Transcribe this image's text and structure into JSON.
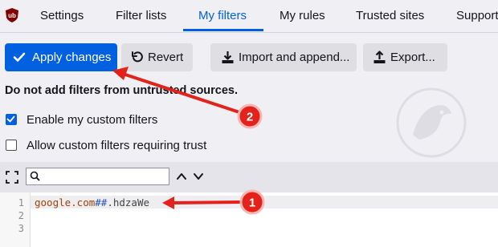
{
  "tabs": [
    {
      "label": "Settings",
      "active": false
    },
    {
      "label": "Filter lists",
      "active": false
    },
    {
      "label": "My filters",
      "active": true
    },
    {
      "label": "My rules",
      "active": false
    },
    {
      "label": "Trusted sites",
      "active": false
    },
    {
      "label": "Support",
      "active": false
    }
  ],
  "toolbar": {
    "apply_label": "Apply changes",
    "revert_label": "Revert",
    "import_label": "Import and append...",
    "export_label": "Export..."
  },
  "warning": "Do not add filters from untrusted sources.",
  "options": [
    {
      "label": "Enable my custom filters",
      "checked": true
    },
    {
      "label": "Allow custom filters requiring trust",
      "checked": false
    }
  ],
  "editor": {
    "search_value": "",
    "line_numbers": [
      "1",
      "2",
      "3"
    ],
    "lines": [
      {
        "domain": "google.com",
        "separator": "##",
        "selector": ".hdzaWe"
      }
    ]
  },
  "annotations": {
    "badge_1": "1",
    "badge_2": "2",
    "color": "#e3221b"
  },
  "colors": {
    "accent": "#0060df",
    "brand": "#800000"
  }
}
